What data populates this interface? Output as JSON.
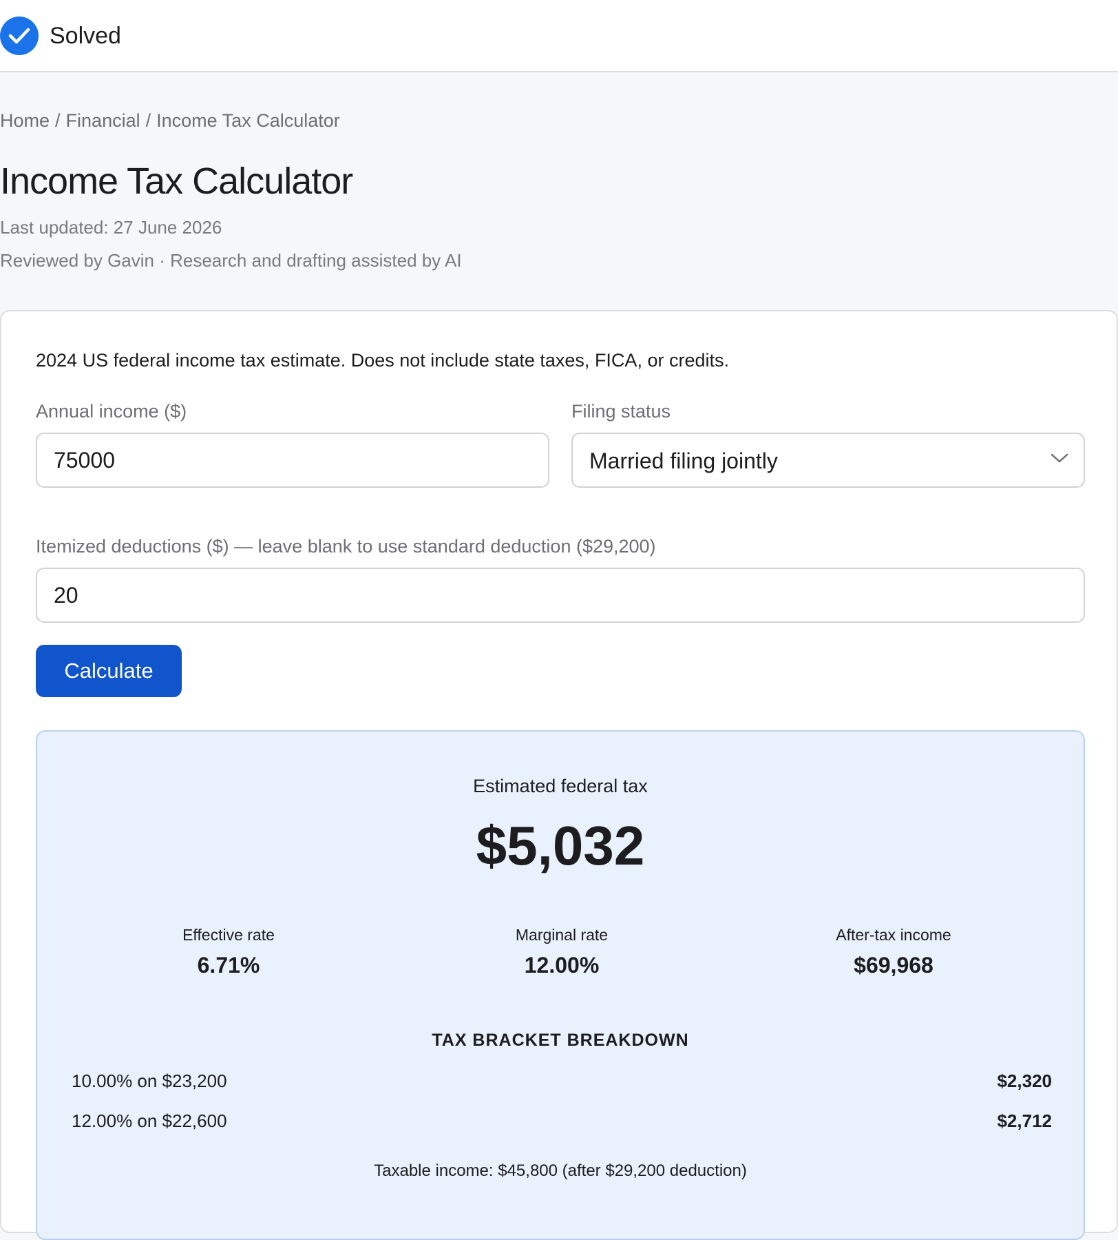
{
  "status": {
    "label": "Solved",
    "icon": "check-circle-icon",
    "color": "#1a73e8"
  },
  "breadcrumb": {
    "home": "Home",
    "category": "Financial",
    "current": "Income Tax Calculator",
    "separator": "/"
  },
  "header": {
    "title": "Income Tax Calculator",
    "last_updated": "Last updated: 27 June 2026",
    "reviewed": "Reviewed by Gavin · Research and drafting assisted by AI"
  },
  "form": {
    "intro": "2024 US federal income tax estimate. Does not include state taxes, FICA, or credits.",
    "income_label": "Annual income ($)",
    "income_value": "75000",
    "filing_label": "Filing status",
    "filing_value": "Married filing jointly",
    "itemized_label": "Itemized deductions ($) — leave blank to use standard deduction ($29,200)",
    "itemized_value": "20",
    "calculate_label": "Calculate",
    "button_color": "#1155cc"
  },
  "results": {
    "title": "Estimated federal tax",
    "total": "$5,032",
    "stats": [
      {
        "label": "Effective rate",
        "value": "6.71%"
      },
      {
        "label": "Marginal rate",
        "value": "12.00%"
      },
      {
        "label": "After-tax income",
        "value": "$69,968"
      }
    ],
    "bracket_heading": "TAX BRACKET BREAKDOWN",
    "brackets": [
      {
        "description": "10.00% on $23,200",
        "amount": "$2,320"
      },
      {
        "description": "12.00% on $22,600",
        "amount": "$2,712"
      }
    ],
    "taxable_note": "Taxable income: $45,800 (after $29,200 deduction)",
    "panel_color": "#e8f1fc"
  }
}
